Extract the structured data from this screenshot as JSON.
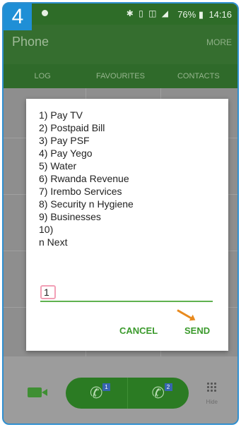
{
  "step_badge": "4",
  "status": {
    "signal_icons": "✱ ▯ ◫ ◢",
    "battery": "76% ▮",
    "time": "14:16"
  },
  "app": {
    "title": "Phone",
    "more": "MORE",
    "tabs": [
      "LOG",
      "FAVOURITES",
      "CONTACTS"
    ]
  },
  "dialog": {
    "lines": [
      "1) Pay TV",
      "2) Postpaid Bill",
      "3) Pay PSF",
      "4) Pay Yego",
      "5) Water",
      "6) Rwanda Revenue",
      "7) Irembo Services",
      "8) Security n Hygiene",
      "9) Businesses",
      "10)",
      "n Next"
    ],
    "input_value": "1",
    "cancel_label": "CANCEL",
    "send_label": "SEND"
  },
  "bottom": {
    "sim1": "1",
    "sim2": "2",
    "hide_label": "Hide"
  },
  "colors": {
    "accent_green": "#3b9a2c",
    "app_bar": "#356e2f",
    "badge_blue": "#1f8fd6",
    "arrow_orange": "#e88a1f",
    "input_border": "#f2a0b6"
  }
}
